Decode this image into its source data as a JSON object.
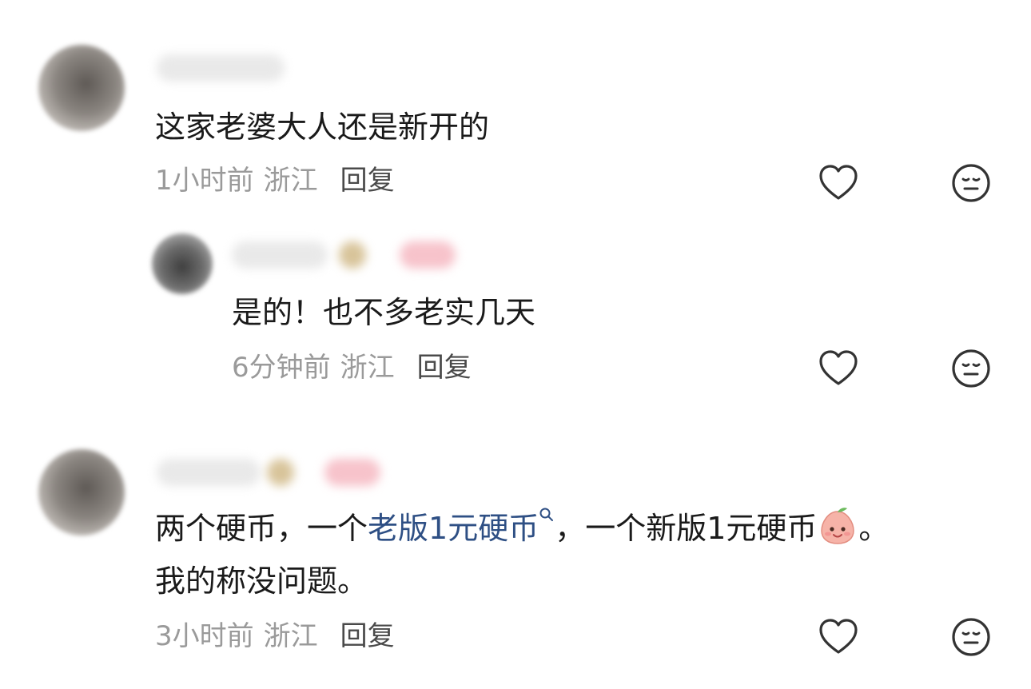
{
  "comments": [
    {
      "text": "这家老婆大人还是新开的",
      "time": "1小时前",
      "location": "浙江",
      "reply_label": "回复",
      "like_icon": "heart-outline-icon",
      "emoji_icon": "expressionless-face-icon"
    },
    {
      "text": "是的！也不多老实几天",
      "time": "6分钟前",
      "location": "浙江",
      "reply_label": "回复",
      "like_icon": "heart-outline-icon",
      "emoji_icon": "expressionless-face-icon"
    },
    {
      "text_part1": "两个硬币，一个",
      "link_text": "老版1元硬币",
      "text_part2": "，一个新版1元硬币",
      "text_part3": "。",
      "text_line2": "我的称没问题。",
      "emoji": "peach-face-emoji",
      "time": "3小时前",
      "location": "浙江",
      "reply_label": "回复",
      "like_icon": "heart-outline-icon",
      "emoji_icon": "expressionless-face-icon"
    }
  ],
  "colors": {
    "text": "#1a1a1a",
    "meta": "#9a9a9a",
    "reply": "#4a4a4a",
    "link": "#2e4f84",
    "icon": "#333333"
  }
}
